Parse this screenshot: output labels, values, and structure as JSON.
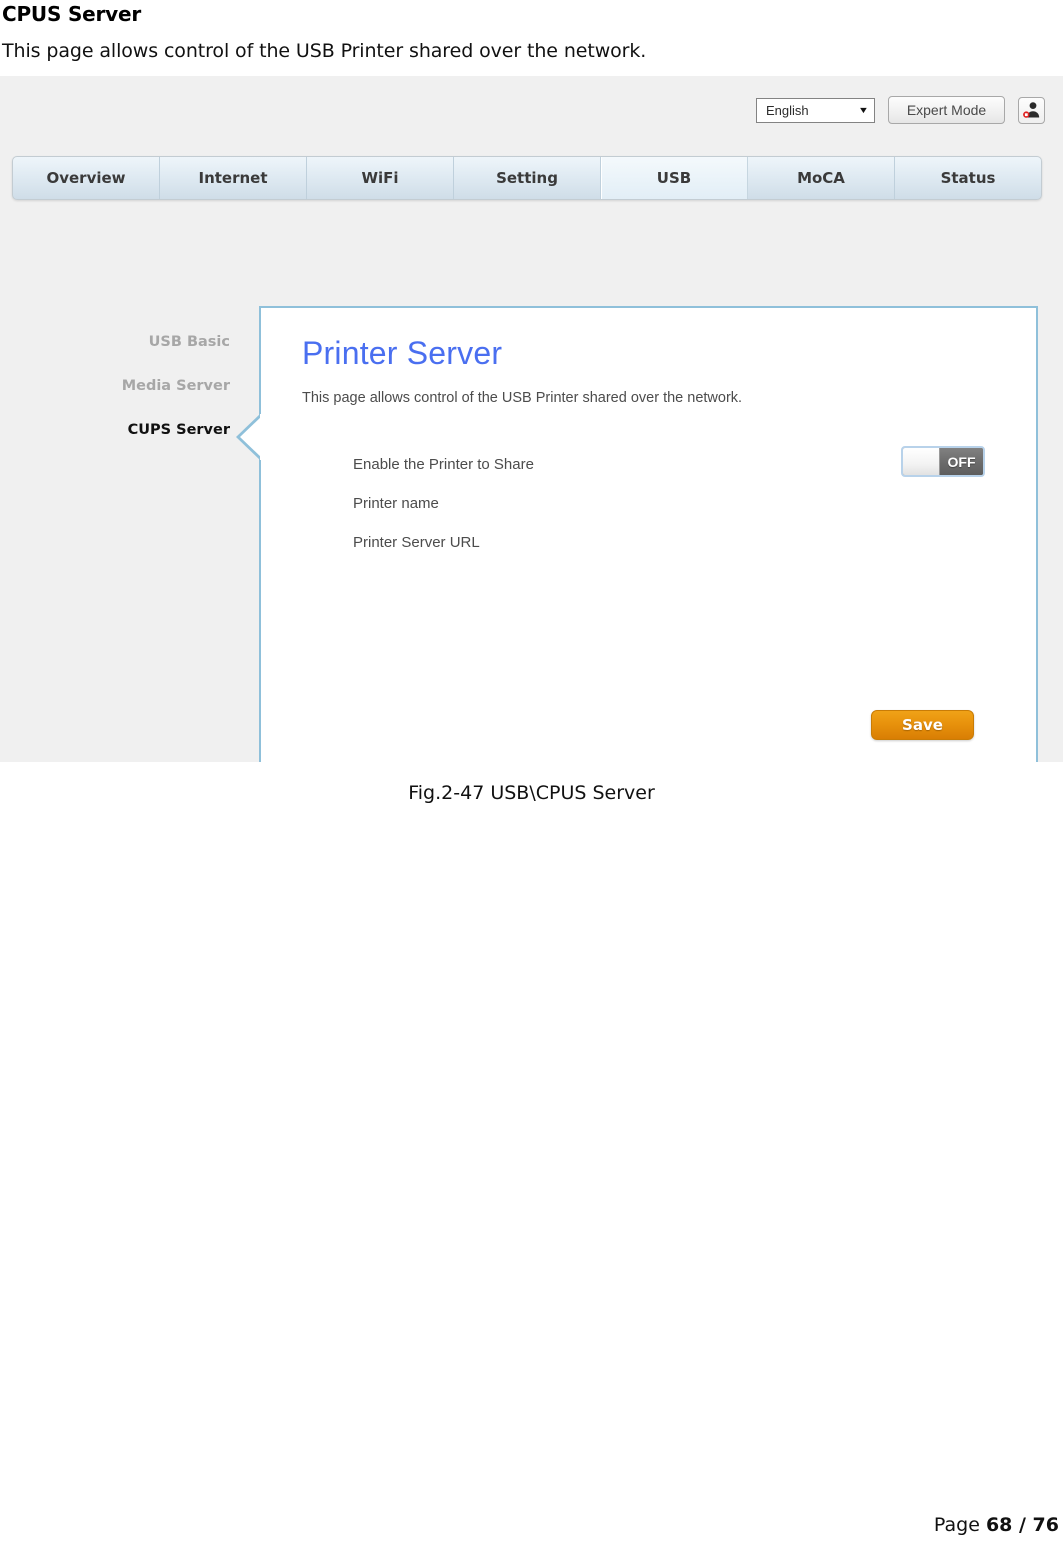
{
  "document": {
    "heading": "CPUS Server",
    "subtitle": "This page allows control of the USB Printer shared over the network.",
    "figure_caption": "Fig.2-47 USB\\CPUS Server",
    "footer": {
      "label": "Page ",
      "pages": "68 / 76"
    }
  },
  "screenshot": {
    "topbar": {
      "language_value": "English",
      "language_caret": "▼",
      "expert_mode_label": "Expert Mode",
      "user_icon_name": "user-account-icon"
    },
    "tabs": [
      {
        "label": "Overview",
        "active": false
      },
      {
        "label": "Internet",
        "active": false
      },
      {
        "label": "WiFi",
        "active": false
      },
      {
        "label": "Setting",
        "active": false
      },
      {
        "label": "USB",
        "active": true
      },
      {
        "label": "MoCA",
        "active": false
      },
      {
        "label": "Status",
        "active": false
      }
    ],
    "sidebar": [
      {
        "label": "USB Basic",
        "active": false
      },
      {
        "label": "Media Server",
        "active": false
      },
      {
        "label": "CUPS Server",
        "active": true
      }
    ],
    "panel": {
      "title": "Printer Server",
      "description": "This page allows control of the USB Printer shared over the network.",
      "rows": [
        {
          "label": "Enable the Printer to Share",
          "value": "",
          "control": "toggle",
          "toggle_state": "OFF"
        },
        {
          "label": "Printer name",
          "value": "",
          "control": "text"
        },
        {
          "label": "Printer Server URL",
          "value": "",
          "control": "text"
        }
      ],
      "save_label": "Save"
    },
    "colors": {
      "panel_border": "#8fc0da",
      "panel_title": "#4a6ff0",
      "save_button": "#e8920c",
      "toggle_off": "#6b6b6b",
      "page_background": "#f0f0f0"
    }
  }
}
